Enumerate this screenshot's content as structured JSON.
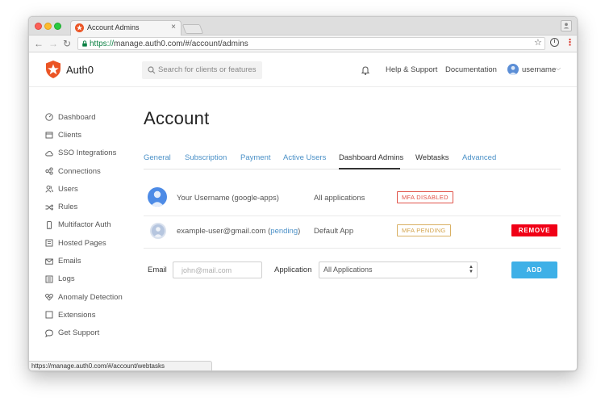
{
  "browser": {
    "tab_title": "Account Admins",
    "url_scheme": "https://",
    "url_rest": "manage.auth0.com/#/account/admins",
    "status_url": "https://manage.auth0.com/#/account/webtasks"
  },
  "header": {
    "logo_text": "Auth0",
    "search_placeholder": "Search for clients or features",
    "help_label": "Help & Support",
    "docs_label": "Documentation",
    "username": "username"
  },
  "sidebar": {
    "items": [
      {
        "label": "Dashboard",
        "icon": "dashboard-icon"
      },
      {
        "label": "Clients",
        "icon": "clients-icon"
      },
      {
        "label": "SSO Integrations",
        "icon": "cloud-icon"
      },
      {
        "label": "Connections",
        "icon": "connections-icon"
      },
      {
        "label": "Users",
        "icon": "users-icon"
      },
      {
        "label": "Rules",
        "icon": "shuffle-icon"
      },
      {
        "label": "Multifactor Auth",
        "icon": "phone-icon"
      },
      {
        "label": "Hosted Pages",
        "icon": "page-icon"
      },
      {
        "label": "Emails",
        "icon": "mail-icon"
      },
      {
        "label": "Logs",
        "icon": "logs-icon"
      },
      {
        "label": "Anomaly Detection",
        "icon": "heart-icon"
      },
      {
        "label": "Extensions",
        "icon": "extensions-icon"
      },
      {
        "label": "Get Support",
        "icon": "chat-icon"
      }
    ]
  },
  "page": {
    "title": "Account",
    "tabs": [
      {
        "label": "General"
      },
      {
        "label": "Subscription"
      },
      {
        "label": "Payment"
      },
      {
        "label": "Active Users"
      },
      {
        "label": "Dashboard Admins"
      },
      {
        "label": "Webtasks"
      },
      {
        "label": "Advanced"
      }
    ],
    "active_tab": "Dashboard Admins"
  },
  "admins": [
    {
      "name": "Your Username (google-apps)",
      "app": "All applications",
      "badge": "MFA DISABLED"
    },
    {
      "name": "example-user@gmail.com",
      "pending": "pending",
      "app": "Default App",
      "badge": "MFA PENDING",
      "action": "REMOVE"
    }
  ],
  "add_form": {
    "email_label": "Email",
    "email_placeholder": "john@mail.com",
    "application_label": "Application",
    "application_value": "All Applications",
    "add_label": "ADD"
  },
  "colors": {
    "accent_blue": "#4a90c7",
    "remove_red": "#f00016",
    "add_blue": "#3eb0e7",
    "badge_disabled": "#e0544a",
    "badge_pending": "#d3a34b",
    "brand": "#eb5424"
  }
}
